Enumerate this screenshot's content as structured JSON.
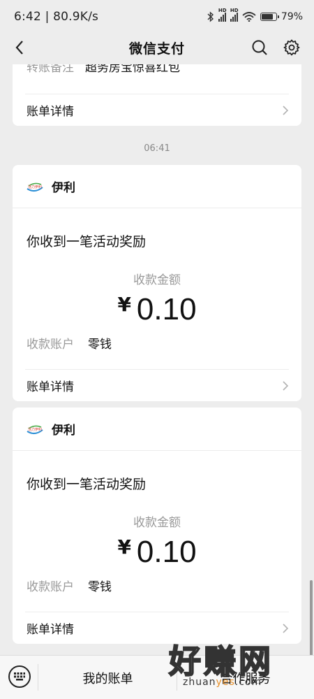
{
  "status_bar": {
    "time_speed": "6:42 | 80.9K/s",
    "hd_label": "HD",
    "battery": "79%",
    "battery_level": 0.79
  },
  "title_bar": {
    "title": "微信支付"
  },
  "prev_card": {
    "partial_label": "转账备注",
    "partial_value": "超务房宝惊喜红包",
    "detail": "账单详情"
  },
  "time_separator": "06:41",
  "cards": [
    {
      "merchant": "伊利",
      "logo_text": "活力伊利",
      "headline": "你收到一笔活动奖励",
      "amount_label": "收款金额",
      "currency": "¥",
      "amount": "0.10",
      "account_label": "收款账户",
      "account_value": "零钱",
      "detail": "账单详情"
    },
    {
      "merchant": "伊利",
      "logo_text": "活力伊利",
      "headline": "你收到一笔活动奖励",
      "amount_label": "收款金额",
      "currency": "¥",
      "amount": "0.10",
      "account_label": "收款账户",
      "account_value": "零钱",
      "detail": "账单详情"
    }
  ],
  "bottom_bar": {
    "item1": "我的账单",
    "item2": "合作服务"
  },
  "watermark": {
    "big": "好赚网",
    "small_pre": "zhuan",
    "small_acc": "yes",
    "small_post": ".com"
  },
  "colors": {
    "background": "#ededed",
    "card": "#ffffff",
    "muted_text": "#999999",
    "text": "#111111"
  }
}
